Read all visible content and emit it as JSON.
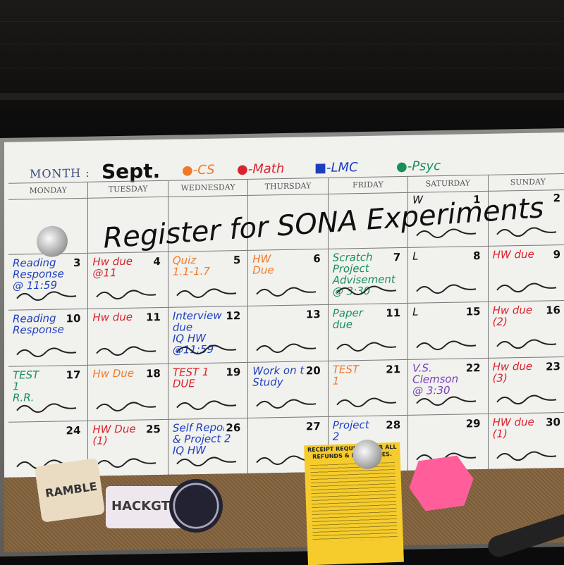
{
  "board": {
    "month_label": "MONTH :",
    "month_value": "Sept.",
    "legend": [
      {
        "label": "CS",
        "color": "#f07a2a"
      },
      {
        "label": "Math",
        "color": "#d9232e"
      },
      {
        "label": "LMC",
        "color": "#1d3fbf"
      },
      {
        "label": "Psyc",
        "color": "#1a8f5a"
      }
    ],
    "days": [
      "MONDAY",
      "TUESDAY",
      "WEDNESDAY",
      "THURSDAY",
      "FRIDAY",
      "SATURDAY",
      "SUNDAY"
    ],
    "week1_text": "Register for SONA Experiments",
    "cells": [
      {
        "num": "",
        "note": "",
        "color": "#111"
      },
      {
        "num": "",
        "note": "",
        "color": "#111"
      },
      {
        "num": "",
        "note": "",
        "color": "#111"
      },
      {
        "num": "",
        "note": "",
        "color": "#111"
      },
      {
        "num": "",
        "note": "",
        "color": "#111"
      },
      {
        "num": "1",
        "note": "W",
        "color": "#111"
      },
      {
        "num": "2",
        "note": "",
        "color": "#111"
      },
      {
        "num": "3",
        "note": "Reading\nResponse\n@ 11:59",
        "color": "#1d3fbf"
      },
      {
        "num": "4",
        "note": "Hw due\n@11",
        "color": "#d9232e"
      },
      {
        "num": "5",
        "note": "Quiz\n1.1-1.7",
        "color": "#f07a2a"
      },
      {
        "num": "6",
        "note": "HW\nDue",
        "color": "#f07a2a"
      },
      {
        "num": "7",
        "note": "Scratch\nProject\nAdvisement\n@ 3:30",
        "color": "#1a8f5a"
      },
      {
        "num": "8",
        "note": "L",
        "color": "#111"
      },
      {
        "num": "9",
        "note": "HW due",
        "color": "#d9232e"
      },
      {
        "num": "10",
        "note": "Reading\nResponse",
        "color": "#1d3fbf"
      },
      {
        "num": "11",
        "note": "Hw due",
        "color": "#d9232e"
      },
      {
        "num": "12",
        "note": "Interview\ndue\nIQ HW\n@11:59",
        "color": "#1d3fbf"
      },
      {
        "num": "13",
        "note": "",
        "color": "#111"
      },
      {
        "num": "11",
        "note": "Paper\ndue",
        "color": "#1a8f5a"
      },
      {
        "num": "15",
        "note": "L",
        "color": "#111"
      },
      {
        "num": "16",
        "note": "Hw due\n(2)",
        "color": "#d9232e"
      },
      {
        "num": "17",
        "note": "TEST\n1\nR.R.",
        "color": "#1a8f5a"
      },
      {
        "num": "18",
        "note": "Hw Due",
        "color": "#f07a2a"
      },
      {
        "num": "19",
        "note": "TEST 1\nDUE",
        "color": "#d9232e"
      },
      {
        "num": "20",
        "note": "Work on the Study",
        "color": "#1d3fbf"
      },
      {
        "num": "21",
        "note": "TEST\n1",
        "color": "#f07a2a"
      },
      {
        "num": "22",
        "note": "V.S.\nClemson\n@ 3:30",
        "color": "#7a3fb8"
      },
      {
        "num": "23",
        "note": "Hw due\n(3)",
        "color": "#d9232e"
      },
      {
        "num": "24",
        "note": "",
        "color": "#111"
      },
      {
        "num": "25",
        "note": "HW Due\n(1)",
        "color": "#d9232e"
      },
      {
        "num": "26",
        "note": "Self Report\n& Project 2\nIQ HW",
        "color": "#1d3fbf"
      },
      {
        "num": "27",
        "note": "",
        "color": "#111"
      },
      {
        "num": "28",
        "note": "Project\n2",
        "color": "#1d3fbf"
      },
      {
        "num": "29",
        "note": "",
        "color": "#111"
      },
      {
        "num": "30",
        "note": "HW due\n(1)",
        "color": "#d9232e"
      }
    ]
  },
  "receipt": {
    "title": "RECEIPT REQUIRED FOR ALL REFUNDS & EXCHANGES."
  },
  "stickers": [
    "RAMBLE",
    "HACKGT"
  ]
}
